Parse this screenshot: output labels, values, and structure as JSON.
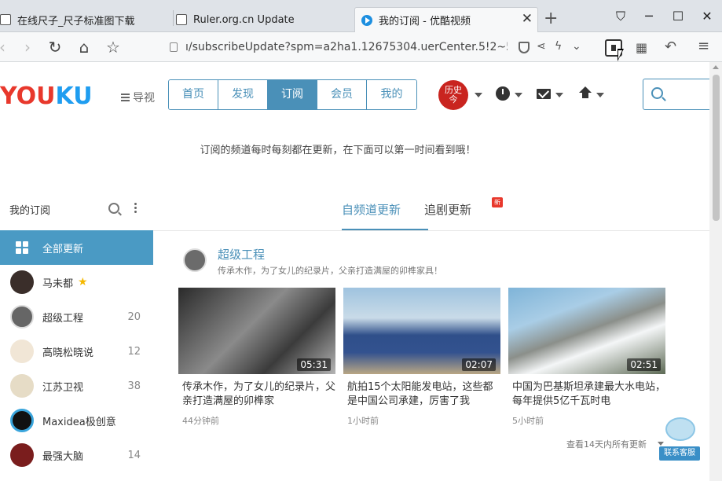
{
  "browser": {
    "tabs": [
      {
        "title": "在线尺子_尺子标准图下载"
      },
      {
        "title": "Ruler.org.cn Update"
      },
      {
        "title": "我的订阅 - 优酷视频"
      }
    ],
    "url": "ı/subscribeUpdate?spm=a2ha1.12675304.uerCenter.5!2~5~A"
  },
  "header": {
    "logo_you": "YOU",
    "logo_ku": "KU",
    "guide_label": "导视",
    "nav": [
      "首页",
      "发现",
      "订阅",
      "会员",
      "我的"
    ],
    "active_nav": "订阅",
    "avatar_text": "历史今"
  },
  "notice": "订阅的频道每时每刻都在更新，在下面可以第一时间看到哦！",
  "sidebar": {
    "title": "我的订阅",
    "items": [
      {
        "label": "全部更新",
        "count": ""
      },
      {
        "label": "马未都",
        "count": ""
      },
      {
        "label": "超级工程",
        "count": "20"
      },
      {
        "label": "高晓松晓说",
        "count": "12"
      },
      {
        "label": "江苏卫视",
        "count": "38"
      },
      {
        "label": "Maxidea极创意",
        "count": ""
      },
      {
        "label": "最强大脑",
        "count": "14"
      }
    ]
  },
  "main": {
    "tabs": [
      "自频道更新",
      "追剧更新"
    ],
    "new_badge": "新",
    "channel": {
      "name": "超级工程",
      "desc": "传承木作，为了女儿的纪录片，父亲打造满屋的卯榫家具！"
    },
    "videos": [
      {
        "duration": "05:31",
        "title": "传承木作，为了女儿的纪录片，父亲打造满屋的卯榫家",
        "time": "44分钟前"
      },
      {
        "duration": "02:07",
        "title": "航拍15个太阳能发电站，这些都是中国公司承建，厉害了我",
        "time": "1小时前"
      },
      {
        "duration": "02:51",
        "title": "中国为巴基斯坦承建最大水电站，每年提供5亿千瓦时电",
        "time": "5小时前"
      }
    ],
    "more_link": "查看14天内所有更新",
    "customer_service": "联系客服"
  },
  "colors": {
    "accent": "#4a90b8",
    "logo_red": "#e8382c",
    "logo_blue": "#1f9df0",
    "sidebar_active": "#4a9ac4"
  }
}
